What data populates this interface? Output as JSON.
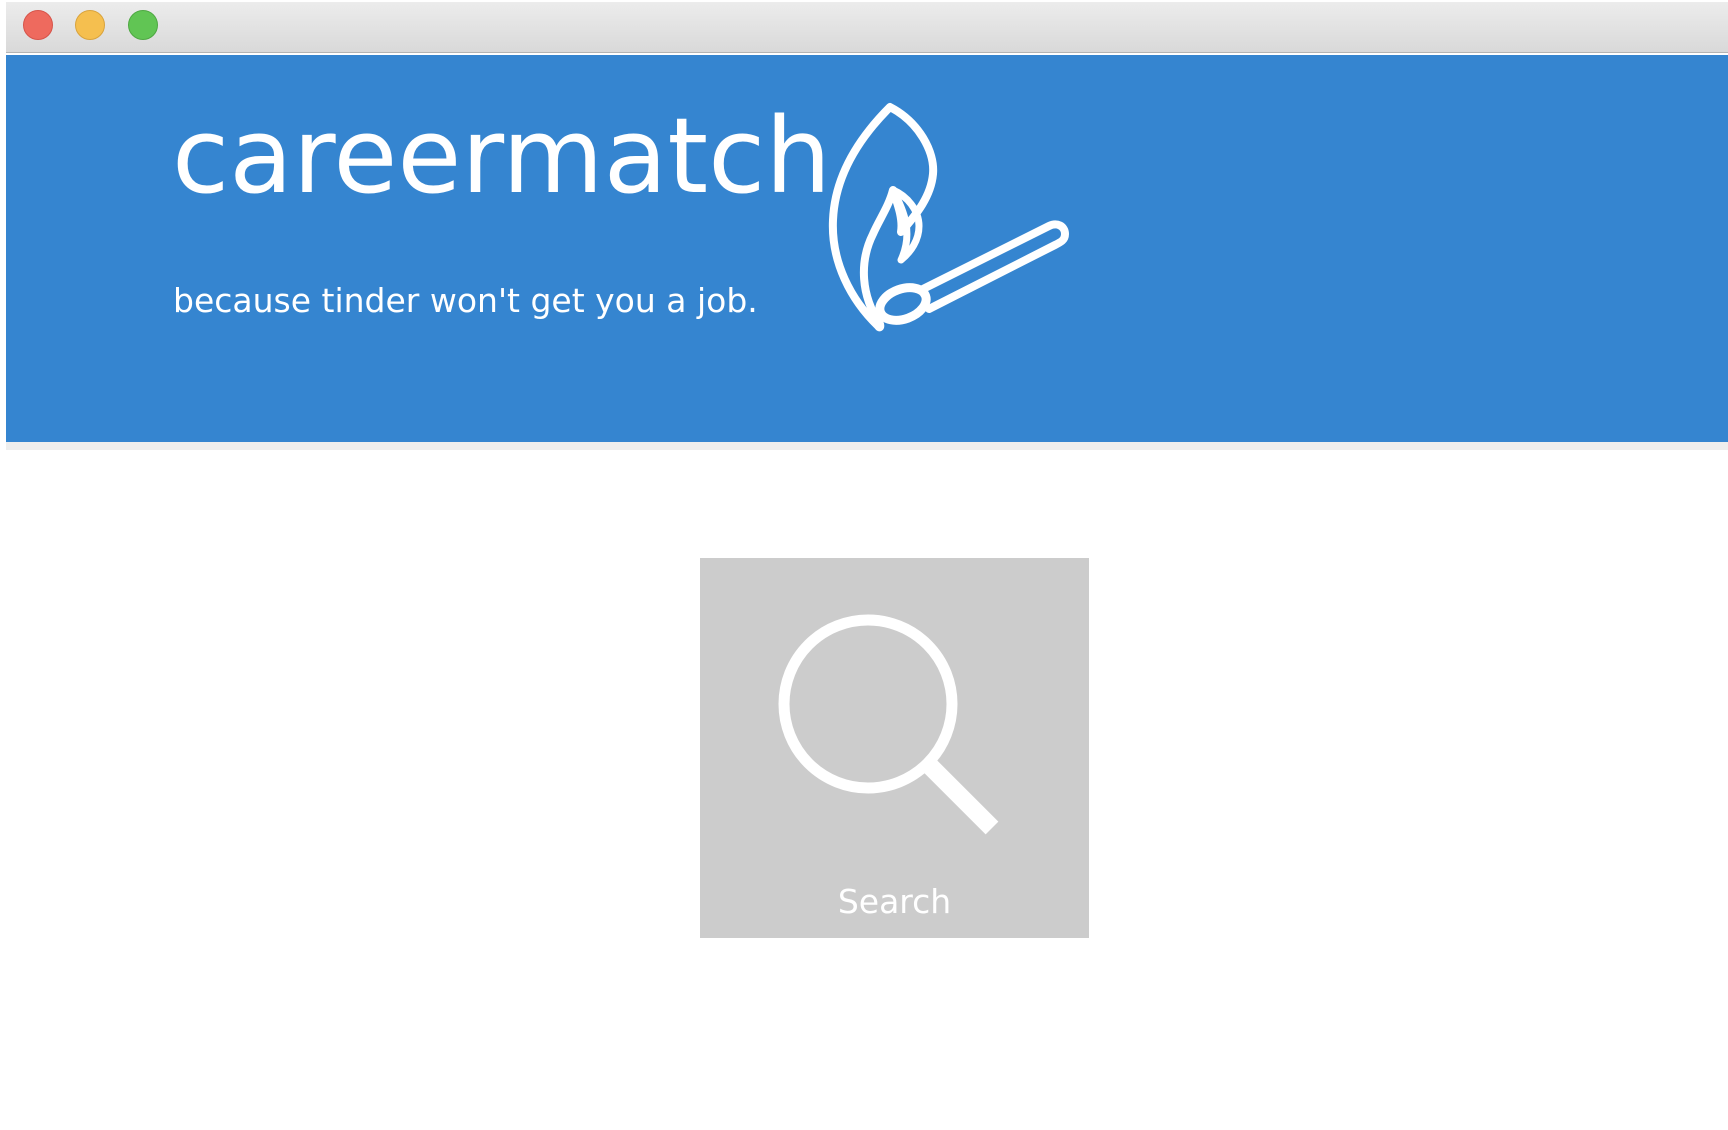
{
  "window": {
    "controls": [
      {
        "name": "close",
        "color": "#ee6a5e"
      },
      {
        "name": "minimize",
        "color": "#f5bf4f"
      },
      {
        "name": "zoom",
        "color": "#61c554"
      }
    ]
  },
  "banner": {
    "title": "careermatch",
    "tagline": "because tinder won't get you a job.",
    "logo_icon": "match-flame-icon",
    "background_color": "#3585d0"
  },
  "main": {
    "search_tile": {
      "label": "Search",
      "icon": "magnifier-icon",
      "background_color": "#cccccc"
    }
  }
}
